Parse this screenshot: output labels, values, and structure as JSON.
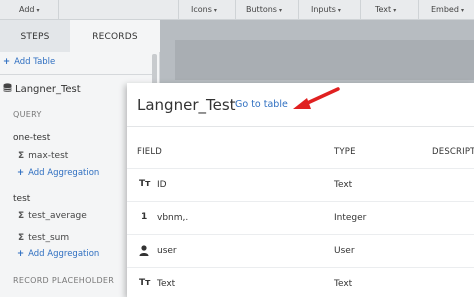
{
  "toolbar": {
    "add": "Add",
    "icons": "Icons",
    "buttons": "Buttons",
    "inputs": "Inputs",
    "text": "Text",
    "embed": "Embed",
    "caret": "▾"
  },
  "sidebar": {
    "tabs": [
      "STEPS",
      "RECORDS"
    ],
    "add_table": "Add Table",
    "table_name": "Langner_Test",
    "query_label": "QUERY",
    "groups": [
      {
        "name": "one-test",
        "aggregations": [
          "max-test"
        ],
        "add_label": "Add Aggregation"
      },
      {
        "name": "test",
        "aggregations": [
          "test_average",
          "test_sum"
        ],
        "add_label": "Add Aggregation"
      }
    ],
    "record_placeholder": "RECORD PLACEHOLDER"
  },
  "modal": {
    "title": "Langner_Test",
    "goto_link": "Go to table",
    "arrow_color": "#e02020",
    "columns": [
      "FIELD",
      "TYPE",
      "DESCRIPTION"
    ],
    "rows": [
      {
        "icon": "text-type-icon",
        "icon_glyph": "Tт",
        "name": "ID",
        "type": "Text"
      },
      {
        "icon": "number-type-icon",
        "icon_glyph": "1",
        "name": "vbnm,.",
        "type": "Integer"
      },
      {
        "icon": "user-type-icon",
        "icon_glyph": "👤",
        "name": "user",
        "type": "User"
      },
      {
        "icon": "text-type-icon",
        "icon_glyph": "Tт",
        "name": "Text",
        "type": "Text"
      }
    ]
  },
  "colors": {
    "link": "#2f6fc1",
    "accent_arrow": "#e02020"
  }
}
